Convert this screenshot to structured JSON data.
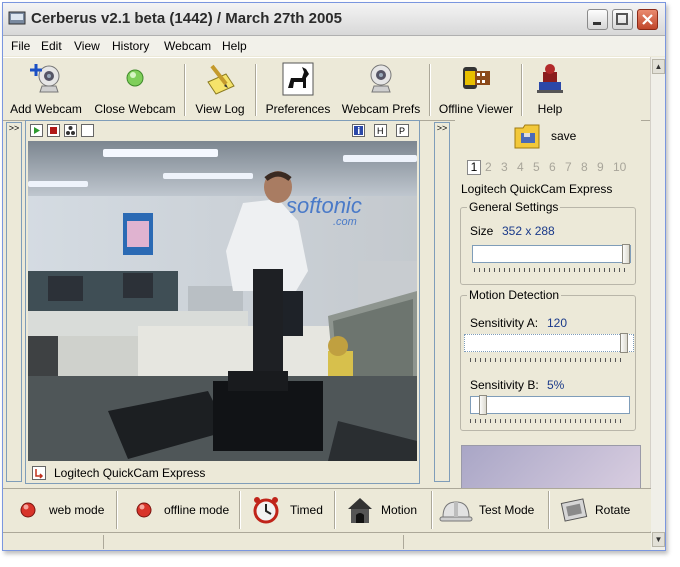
{
  "window": {
    "title": "Cerberus v2.1 beta (1442) / March 27th 2005"
  },
  "menu": {
    "items": [
      "File",
      "Edit",
      "View",
      "History",
      "Webcam",
      "Help"
    ]
  },
  "toolbar": {
    "add_webcam": "Add Webcam",
    "close_webcam": "Close Webcam",
    "view_log": "View Log",
    "preferences": "Preferences",
    "webcam_prefs": "Webcam Prefs",
    "offline_viewer": "Offline Viewer",
    "help": "Help"
  },
  "video": {
    "collapse_left": ">>",
    "caption": "Logitech QuickCam Express",
    "sign_text": "softonic",
    "sign_sub": ".com"
  },
  "right_panel": {
    "collapse": ">>",
    "save_label": "save",
    "cam_numbers": [
      "1",
      "2",
      "3",
      "4",
      "5",
      "6",
      "7",
      "8",
      "9",
      "10"
    ],
    "selected_cam": "1",
    "camera_name": "Logitech QuickCam Express",
    "general_settings": {
      "title": "General Settings",
      "size_label": "Size",
      "size_value": "352 x 288",
      "slider_level": 1.0
    },
    "motion_detection": {
      "title": "Motion Detection",
      "sens_a_label": "Sensitivity A:",
      "sens_a_value": "120",
      "sens_a_level": 0.97,
      "sens_b_label": "Sensitivity B:",
      "sens_b_value": "5%",
      "sens_b_level": 0.05
    }
  },
  "bottom": {
    "web_mode": "web mode",
    "offline_mode": "offline mode",
    "timed": "Timed",
    "motion": "Motion",
    "test_mode": "Test Mode",
    "rotate": "Rotate"
  },
  "colors": {
    "accent_blue": "#1a3a8a",
    "record_red": "#d8342a",
    "play_green": "#2e9a2e"
  }
}
